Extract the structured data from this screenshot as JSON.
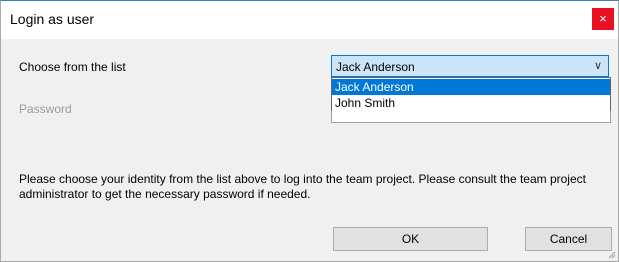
{
  "window": {
    "title": "Login as user",
    "close_glyph": "×"
  },
  "form": {
    "choose_label": "Choose from the list",
    "password_label": "Password",
    "selected_user": "Jack Anderson",
    "dropdown_arrow": "∨",
    "options": [
      "Jack Anderson",
      "John Smith"
    ],
    "highlighted_option_index": 0
  },
  "info_text": "Please choose your identity from the list above to log into the team project. Please consult the team project administrator to get the necessary password if needed.",
  "buttons": {
    "ok": "OK",
    "cancel": "Cancel"
  },
  "colors": {
    "title_close_bg": "#e81123",
    "combo_bg": "#cce4f7",
    "combo_border": "#0078d7",
    "selection_bg": "#0078d7",
    "dialog_bg": "#f0f0f0",
    "disabled_text": "#9b9b9b"
  },
  "icons": {
    "close": "close-icon",
    "dropdown": "chevron-down-icon",
    "resize": "resize-grip-icon"
  }
}
